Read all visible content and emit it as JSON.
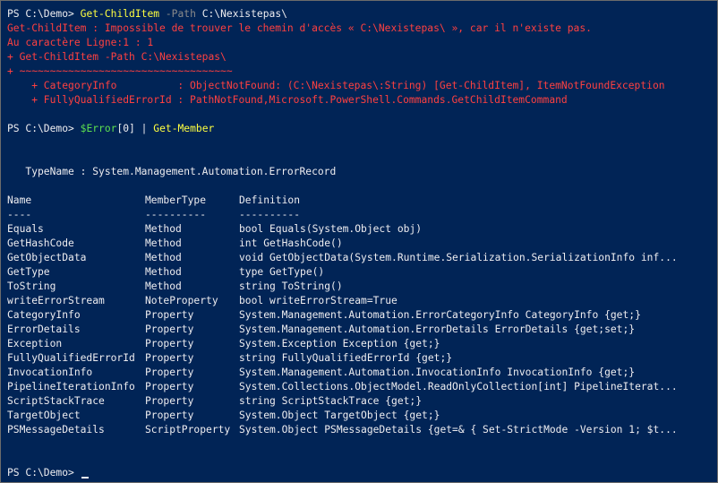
{
  "prompt": "PS C:\\Demo>",
  "command1": {
    "cmdlet": "Get-ChildItem",
    "param": "-Path",
    "arg": "C:\\Nexistepas\\"
  },
  "error_lines": [
    "Get-ChildItem : Impossible de trouver le chemin d'accès « C:\\Nexistepas\\ », car il n'existe pas.",
    "Au caractère Ligne:1 : 1",
    "+ Get-ChildItem -Path C:\\Nexistepas\\",
    "+ ~~~~~~~~~~~~~~~~~~~~~~~~~~~~~~~~~~~",
    "    + CategoryInfo          : ObjectNotFound: (C:\\Nexistepas\\:String) [Get-ChildItem], ItemNotFoundException",
    "    + FullyQualifiedErrorId : PathNotFound,Microsoft.PowerShell.Commands.GetChildItemCommand"
  ],
  "command2": {
    "variable": "$Error",
    "index": "[0]",
    "pipe": "|",
    "cmdlet": "Get-Member"
  },
  "typename_line": "   TypeName : System.Management.Automation.ErrorRecord",
  "member_table": {
    "headers": [
      "Name",
      "MemberType",
      "Definition"
    ],
    "separators": [
      "----",
      "----------",
      "----------"
    ],
    "rows": [
      [
        "Equals",
        "Method",
        "bool Equals(System.Object obj)"
      ],
      [
        "GetHashCode",
        "Method",
        "int GetHashCode()"
      ],
      [
        "GetObjectData",
        "Method",
        "void GetObjectData(System.Runtime.Serialization.SerializationInfo inf..."
      ],
      [
        "GetType",
        "Method",
        "type GetType()"
      ],
      [
        "ToString",
        "Method",
        "string ToString()"
      ],
      [
        "writeErrorStream",
        "NoteProperty",
        "bool writeErrorStream=True"
      ],
      [
        "CategoryInfo",
        "Property",
        "System.Management.Automation.ErrorCategoryInfo CategoryInfo {get;}"
      ],
      [
        "ErrorDetails",
        "Property",
        "System.Management.Automation.ErrorDetails ErrorDetails {get;set;}"
      ],
      [
        "Exception",
        "Property",
        "System.Exception Exception {get;}"
      ],
      [
        "FullyQualifiedErrorId",
        "Property",
        "string FullyQualifiedErrorId {get;}"
      ],
      [
        "InvocationInfo",
        "Property",
        "System.Management.Automation.InvocationInfo InvocationInfo {get;}"
      ],
      [
        "PipelineIterationInfo",
        "Property",
        "System.Collections.ObjectModel.ReadOnlyCollection[int] PipelineIterat..."
      ],
      [
        "ScriptStackTrace",
        "Property",
        "string ScriptStackTrace {get;}"
      ],
      [
        "TargetObject",
        "Property",
        "System.Object TargetObject {get;}"
      ],
      [
        "PSMessageDetails",
        "ScriptProperty",
        "System.Object PSMessageDetails {get=& { Set-StrictMode -Version 1; $t..."
      ]
    ]
  },
  "colors": {
    "background": "#012456",
    "foreground": "#eeedf0",
    "error": "#ff4040",
    "cmdlet": "#ffff40",
    "parameter": "#8a8a8a",
    "variable": "#5de04f"
  }
}
